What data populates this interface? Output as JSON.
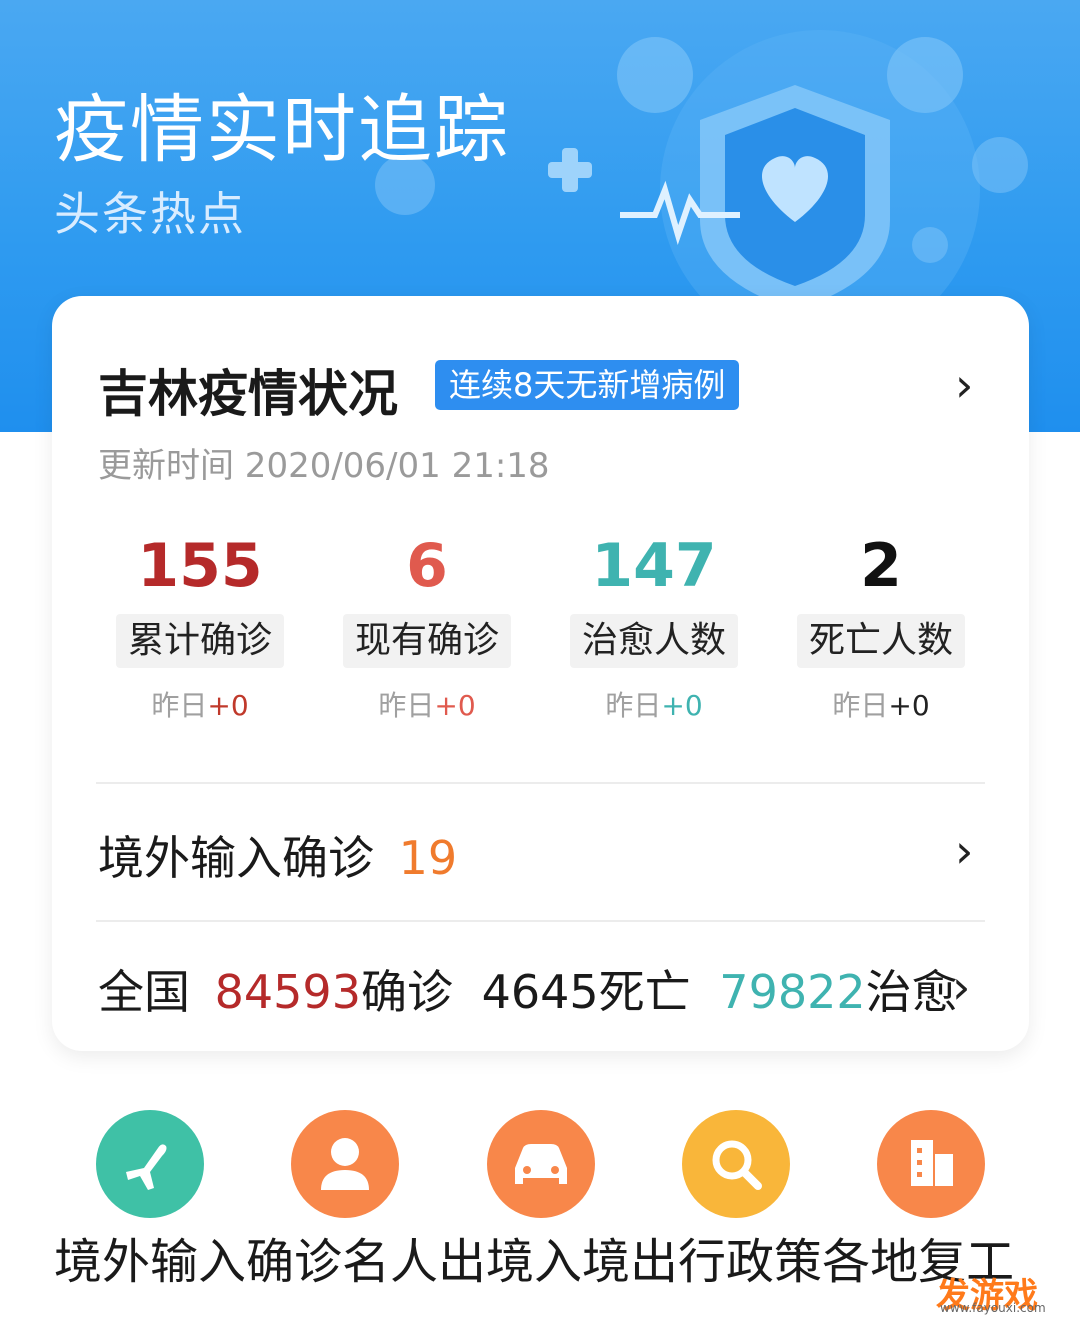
{
  "hero": {
    "title": "疫情实时追踪",
    "subtitle": "头条热点"
  },
  "card": {
    "title": "吉林疫情状况",
    "badge": "连续8天无新增病例",
    "update_time": "更新时间 2020/06/01 21:18",
    "stats": [
      {
        "value": "155",
        "label": "累计确诊",
        "delta_label": "昨日",
        "delta": "+0",
        "color": "#b52a2a",
        "delta_color": "#c0392b"
      },
      {
        "value": "6",
        "label": "现有确诊",
        "delta_label": "昨日",
        "delta": "+0",
        "color": "#e05a4e",
        "delta_color": "#e05a4e"
      },
      {
        "value": "147",
        "label": "治愈人数",
        "delta_label": "昨日",
        "delta": "+0",
        "color": "#3fb3b0",
        "delta_color": "#3fb3b0"
      },
      {
        "value": "2",
        "label": "死亡人数",
        "delta_label": "昨日",
        "delta": "+0",
        "color": "#111111",
        "delta_color": "#222222"
      }
    ],
    "imported": {
      "label": "境外输入确诊",
      "value": "19",
      "color": "#f07b2d"
    },
    "national": {
      "prefix": "全国",
      "confirmed": "84593",
      "confirmed_label": "确诊",
      "deaths": "4645",
      "deaths_label": "死亡",
      "cured": "79822",
      "cured_label": "治愈",
      "confirmed_color": "#b52a2a",
      "cured_color": "#3fb3b0"
    }
  },
  "shortcuts": [
    {
      "label": "境外输入确诊",
      "icon": "airplane-icon",
      "color": "#3fc1a6"
    },
    {
      "label": "名人",
      "icon": "person-icon",
      "color": "#f8874a"
    },
    {
      "label": "出境入境",
      "icon": "car-icon",
      "color": "#f8874a"
    },
    {
      "label": "出行政策",
      "icon": "search-icon",
      "color": "#f9b63a"
    },
    {
      "label": "各地复工",
      "icon": "building-icon",
      "color": "#f8874a"
    }
  ],
  "shortcut_text": "境外输入确诊名人出境入境出行政策各地复工",
  "watermark": {
    "text": "发游戏",
    "url": "www.fayouxi.com"
  }
}
